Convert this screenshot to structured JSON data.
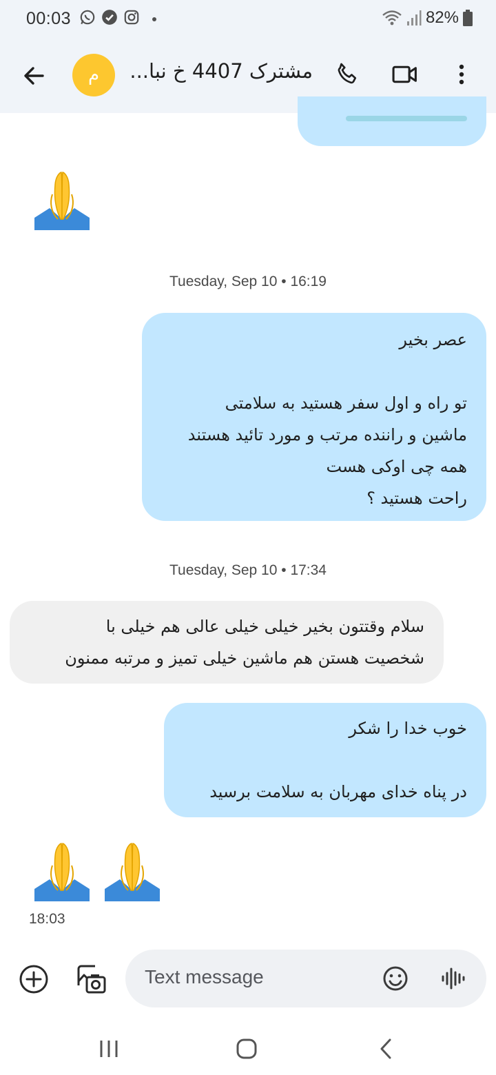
{
  "status_bar": {
    "time": "00:03",
    "battery": "82%",
    "icons_left": [
      "whatsapp-icon",
      "shield-check-icon",
      "instagram-icon"
    ],
    "icons_right": [
      "wifi-icon",
      "signal-icon",
      "battery-icon"
    ]
  },
  "header": {
    "avatar_letter": "م",
    "contact_name": "مشترک 4407 خ نبا",
    "name_ellipsis": "...",
    "actions": [
      "phone-icon",
      "video-icon",
      "more-vert-icon"
    ]
  },
  "conversation": {
    "timestamp_1": "Tuesday, Sep 10 • 16:19",
    "timestamp_2": "Tuesday, Sep 10 • 17:34",
    "msg_out_1": "عصر بخیر\n\nتو راه و اول سفر هستید به سلامتی\nماشین و راننده مرتب و مورد تائید هستند\nهمه چی اوکی هست\nراحت هستید ؟",
    "msg_in_1": "سلام وقتتون بخیر خیلی خیلی عالی هم خیلی با\nشخصیت هستن هم ماشین خیلی تمیز و مرتبه ممنون",
    "msg_out_2": "خوب خدا را شکر\n\nدر پناه خدای مهربان به سلامت برسید",
    "emoji_time": "18:03"
  },
  "composer": {
    "placeholder": "Text message"
  },
  "colors": {
    "outgoing_bubble": "#c2e7ff",
    "incoming_bubble": "#f0f0f0",
    "avatar": "#fdc72f",
    "header_bg": "#f0f4f9"
  }
}
